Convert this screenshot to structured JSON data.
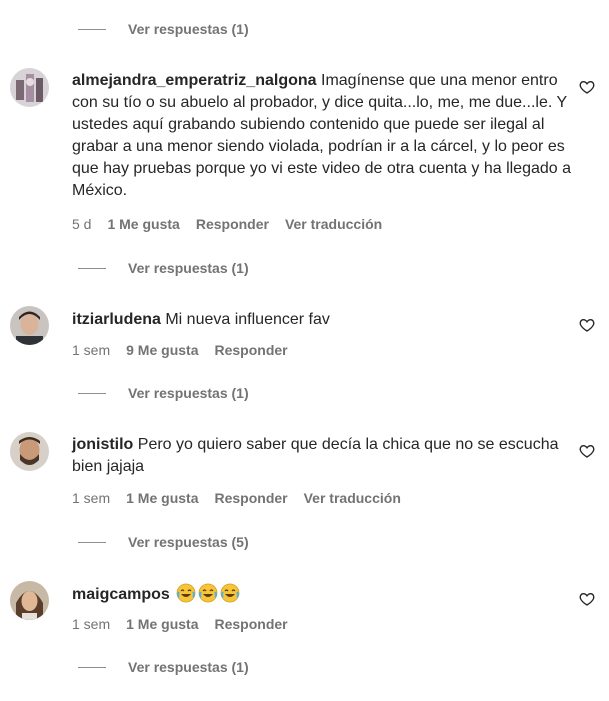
{
  "comments": [
    {
      "username": "almejandra_emperatriz_nalgona",
      "text": " Imagínense que una menor entro con su tío o su abuelo al probador, y dice quita...lo, me, me due...le. Y ustedes aquí grabando subiendo contenido que puede ser ilegal al grabar a una menor siendo violada, podrían ir a la cárcel, y lo peor es que hay pruebas porque yo vi este video de otra cuenta y ha llegado a México.",
      "time": "5 d",
      "likes": "1 Me gusta",
      "reply": "Responder",
      "translate": "Ver traducción",
      "replies": "Ver respuestas (1)"
    },
    {
      "username": "itziarludena",
      "text": " Mi nueva influencer fav",
      "time": "1 sem",
      "likes": "9 Me gusta",
      "reply": "Responder",
      "replies": "Ver respuestas (1)"
    },
    {
      "username": "jonistilo",
      "text": " Pero yo quiero saber que decía la chica que no se escucha bien jajaja",
      "time": "1 sem",
      "likes": "1 Me gusta",
      "reply": "Responder",
      "translate": "Ver traducción",
      "replies": "Ver respuestas (5)"
    },
    {
      "username": "maigcampos",
      "emoji_icons": [
        "laughing-crying-emoji",
        "laughing-crying-emoji",
        "laughing-crying-emoji"
      ],
      "time": "1 sem",
      "likes": "1 Me gusta",
      "reply": "Responder",
      "replies": "Ver respuestas (1)"
    }
  ],
  "top_replies": "Ver respuestas (1)",
  "colors": {
    "text": "#262626",
    "secondary": "#737373",
    "background": "#ffffff"
  },
  "icons": [
    "heart-outline-icon"
  ]
}
